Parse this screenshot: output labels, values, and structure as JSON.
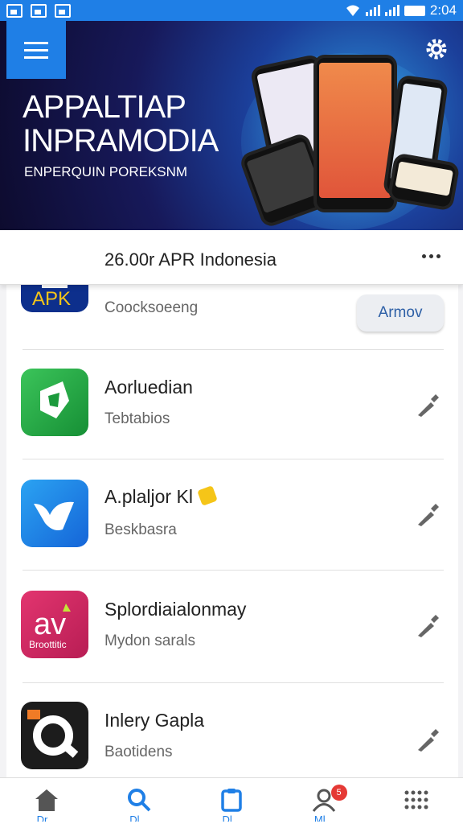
{
  "status_bar": {
    "time": "2:04"
  },
  "banner": {
    "title": "APPALTIAP INPRAMODIA",
    "tagline": "ENPERQUIN POREKSNM"
  },
  "header": {
    "title": "26.00r APR Indonesia"
  },
  "items": [
    {
      "name": "",
      "sub": "Coocksoeeng",
      "icon_text": "APK",
      "icon": "apk-icon",
      "action_label": "Armov"
    },
    {
      "name": "Aorluedian",
      "sub": "Tebtabios",
      "icon": "green-leaf-icon"
    },
    {
      "name": "A.plaljor Kl",
      "sub": "Beskbasra",
      "icon": "blue-bird-icon"
    },
    {
      "name": "Splordiaialonmay",
      "sub": "Mydon sarals",
      "icon_text": "Broottitic",
      "icon": "pink-av-icon"
    },
    {
      "name": "Inlery Gapla",
      "sub": "Baotidens",
      "icon": "search-q-icon"
    }
  ],
  "bottom_nav": [
    {
      "icon": "home-icon",
      "label": "Dr..."
    },
    {
      "icon": "search-icon",
      "label": "Dl..."
    },
    {
      "icon": "clipboard-icon",
      "label": "Dl..."
    },
    {
      "icon": "user-icon",
      "label": "Ml...",
      "badge": "5"
    },
    {
      "icon": "more-grid-icon",
      "label": ""
    }
  ],
  "colors": {
    "accent": "#1f7fe6",
    "badge": "#e53935"
  }
}
